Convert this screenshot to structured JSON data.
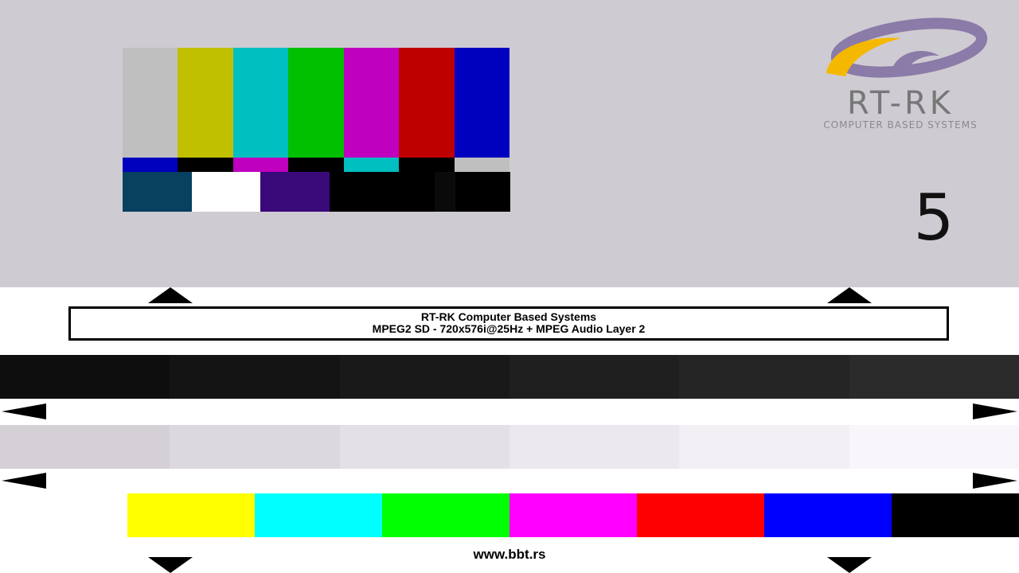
{
  "logo": {
    "title": "RT-RK",
    "subtitle": "COMPUTER BASED SYSTEMS",
    "swirl_purple": "#8b7ba8",
    "swirl_yellow": "#f5b800"
  },
  "counter": "5",
  "info_box": {
    "line1": "RT-RK Computer Based Systems",
    "line2": "MPEG2 SD - 720x576i@25Hz + MPEG Audio Layer 2"
  },
  "website": "www.bbt.rs",
  "colors": {
    "top_background": "#cfcbd2",
    "smpte_top": [
      "#c0bfc0",
      "#c0c000",
      "#00bfc0",
      "#00c000",
      "#bf00bf",
      "#bf0000",
      "#0000bf"
    ],
    "smpte_middle": [
      "#0000bf",
      "#000000",
      "#bf00bf",
      "#000000",
      "#00bfc0",
      "#000000",
      "#c0bfc0"
    ],
    "smpte_bottom": [
      "#08405f",
      "#ffffff",
      "#3a0a7a",
      "#000000",
      "#000000",
      "#0a0a0a",
      "#000000"
    ],
    "dark_steps": [
      "#0e0e0e",
      "#141414",
      "#191919",
      "#1f1f1f",
      "#252525",
      "#2b2b2b"
    ],
    "light_steps": [
      "#d4d0d6",
      "#dcd8e0",
      "#e3e0e8",
      "#ebe8ef",
      "#f2eff5",
      "#f8f6fa"
    ],
    "bottom_bars": [
      "#ffff00",
      "#00ffff",
      "#00ff00",
      "#ff00ff",
      "#ff0000",
      "#0000ff",
      "#000000"
    ]
  }
}
